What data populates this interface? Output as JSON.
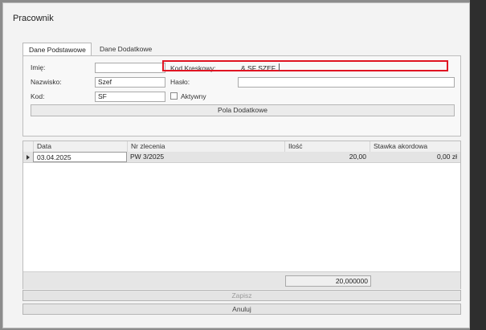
{
  "window": {
    "title": "Pracownik"
  },
  "tabs": [
    {
      "label": "Dane Podstawowe",
      "active": true
    },
    {
      "label": "Dane Dodatkowe",
      "active": false
    }
  ],
  "form": {
    "imie_label": "Imię:",
    "imie_value": "",
    "nazwisko_label": "Nazwisko:",
    "nazwisko_value": "Szef",
    "kod_label": "Kod:",
    "kod_value": "SF",
    "kod_kreskowy_label": "Kod Kreskowy:",
    "kod_kreskowy_value": "& SF SZEF",
    "haslo_label": "Hasło:",
    "haslo_value": "",
    "aktywny_label": "Aktywny",
    "aktywny_checked": false,
    "pola_dodatkowe_button": "Pola Dodatkowe"
  },
  "grid": {
    "columns": [
      "Data",
      "Nr zlecenia",
      "Ilość",
      "Stawka akordowa"
    ],
    "rows": [
      {
        "data": "03.04.2025",
        "nr_zlecenia": "PW 3/2025",
        "ilosc": "20,00",
        "stawka": "0,00 zł"
      }
    ],
    "total": "20,000000"
  },
  "actions": {
    "zapisz": "Zapisz",
    "anuluj": "Anuluj"
  },
  "colors": {
    "highlight_border": "#e01422",
    "background": "#f3f3f3"
  }
}
